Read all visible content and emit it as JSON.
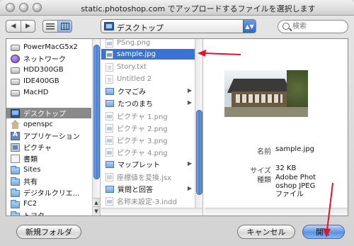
{
  "window": {
    "title": "static.photoshop.com でアップロードするファイルを選択します"
  },
  "toolbar": {
    "back_glyph": "◀",
    "forward_glyph": "▶",
    "location": "デスクトップ",
    "popup_arrows": "▲▼",
    "search_placeholder": "検索"
  },
  "sidebar": {
    "items": [
      {
        "label": "PowerMacG5x2",
        "icon": "drive-icon"
      },
      {
        "label": "ネットワーク",
        "icon": "network-globe-icon"
      },
      {
        "label": "HDD300GB",
        "icon": "drive-icon"
      },
      {
        "label": "IDE400GB",
        "icon": "drive-icon"
      },
      {
        "label": "MacHD",
        "icon": "drive-icon"
      },
      {
        "label": "デスクトップ",
        "icon": "desktop-icon",
        "selected": true
      },
      {
        "label": "openspc",
        "icon": "home-icon"
      },
      {
        "label": "アプリケーション",
        "icon": "applications-icon"
      },
      {
        "label": "ピクチャ",
        "icon": "pictures-icon"
      },
      {
        "label": "書類",
        "icon": "documents-icon"
      },
      {
        "label": "Sites",
        "icon": "folder-icon"
      },
      {
        "label": "共有",
        "icon": "folder-icon"
      },
      {
        "label": "デジタルクリエ...",
        "icon": "folder-icon"
      },
      {
        "label": "FC2",
        "icon": "folder-icon"
      },
      {
        "label": "トヨタ",
        "icon": "folder-icon"
      }
    ]
  },
  "files": {
    "items": [
      {
        "label": "PSng.png",
        "type": "img",
        "dim": true
      },
      {
        "label": "sample.jpg",
        "type": "img",
        "selected": true
      },
      {
        "label": "Story.txt",
        "type": "txt",
        "dim": true
      },
      {
        "label": "Untitled 2",
        "type": "txt",
        "dim": true
      },
      {
        "label": "クマごみ",
        "type": "folder",
        "has_children": true
      },
      {
        "label": "たつのまち",
        "type": "folder",
        "has_children": true
      },
      {
        "label": "ピクチャ 1.png",
        "type": "img",
        "dim": true
      },
      {
        "label": "ピクチャ 2.png",
        "type": "img",
        "dim": true
      },
      {
        "label": "ピクチャ 3.png",
        "type": "img",
        "dim": true
      },
      {
        "label": "ピクチャ 4.png",
        "type": "img",
        "dim": true
      },
      {
        "label": "マップレット",
        "type": "folder",
        "has_children": true
      },
      {
        "label": "座標値を変換.jsx",
        "type": "jsx",
        "dim": true
      },
      {
        "label": "質問と回答",
        "type": "folder",
        "has_children": true
      },
      {
        "label": "名称未設定-3.indd",
        "type": "img",
        "dim": true
      }
    ],
    "child_arrow": "▶"
  },
  "preview": {
    "name_label": "名前",
    "name_value": "sample.jpg",
    "size_label": "サイズ",
    "size_value": "32 KB",
    "kind_label": "種類",
    "kind_value": "Adobe Photoshop JPEG ファイル"
  },
  "buttons": {
    "new_folder": "新規フォルダ",
    "cancel": "キャンセル",
    "open": "開く"
  },
  "colors": {
    "selection": "#3b73d0",
    "annotation": "#e0142a"
  }
}
